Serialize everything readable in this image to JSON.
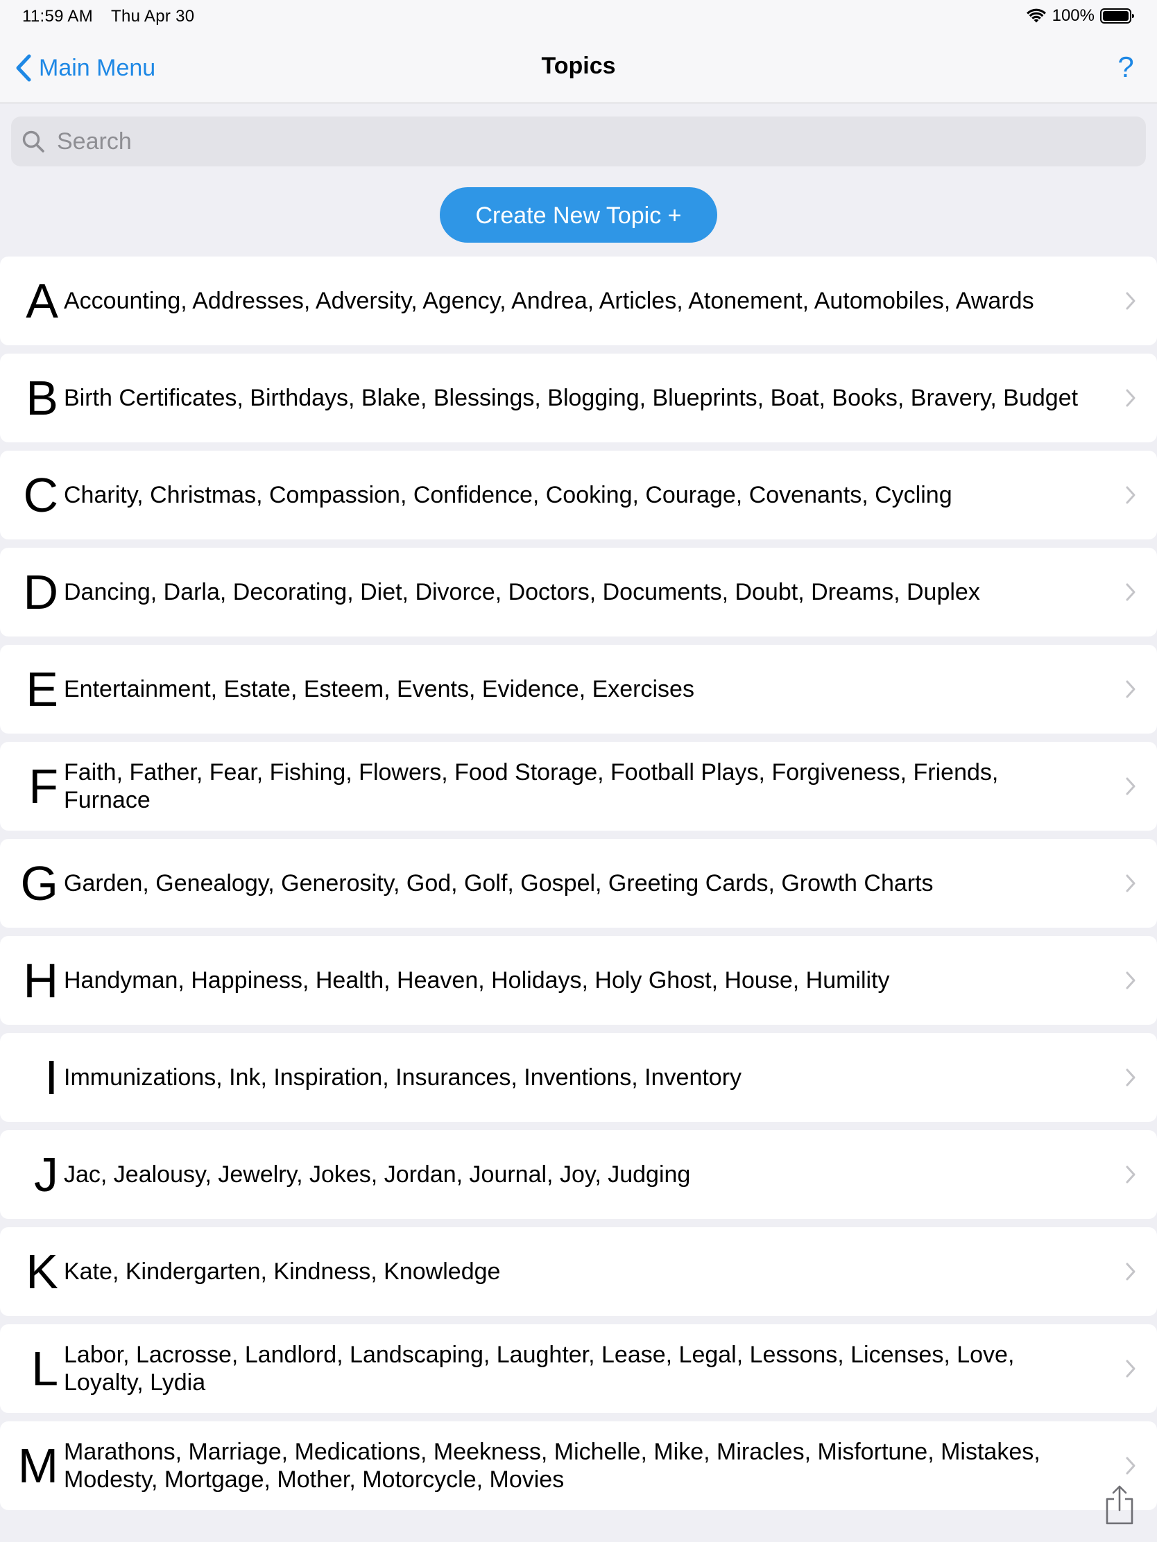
{
  "status_bar": {
    "time": "11:59 AM",
    "date": "Thu Apr 30",
    "battery": "100%"
  },
  "nav": {
    "back_label": "Main Menu",
    "title": "Topics",
    "help": "?"
  },
  "search": {
    "placeholder": "Search",
    "value": ""
  },
  "create_button": "Create New Topic +",
  "topics": [
    {
      "letter": "A",
      "items": "Accounting, Addresses, Adversity, Agency, Andrea, Articles, Atonement, Automobiles, Awards"
    },
    {
      "letter": "B",
      "items": "Birth Certificates, Birthdays, Blake, Blessings, Blogging, Blueprints, Boat, Books, Bravery, Budget"
    },
    {
      "letter": "C",
      "items": "Charity, Christmas, Compassion, Confidence, Cooking, Courage, Covenants, Cycling"
    },
    {
      "letter": "D",
      "items": "Dancing, Darla, Decorating, Diet, Divorce, Doctors, Documents, Doubt, Dreams, Duplex"
    },
    {
      "letter": "E",
      "items": "Entertainment, Estate, Esteem, Events, Evidence, Exercises"
    },
    {
      "letter": "F",
      "items": "Faith, Father, Fear, Fishing, Flowers, Food Storage, Football Plays, Forgiveness, Friends, Furnace"
    },
    {
      "letter": "G",
      "items": "Garden, Genealogy, Generosity, God, Golf, Gospel, Greeting Cards, Growth Charts"
    },
    {
      "letter": "H",
      "items": "Handyman, Happiness, Health, Heaven, Holidays, Holy Ghost, House, Humility"
    },
    {
      "letter": "I",
      "items": "Immunizations, Ink, Inspiration, Insurances, Inventions, Inventory"
    },
    {
      "letter": "J",
      "items": "Jac, Jealousy, Jewelry, Jokes, Jordan, Journal, Joy, Judging"
    },
    {
      "letter": "K",
      "items": "Kate, Kindergarten, Kindness, Knowledge"
    },
    {
      "letter": "L",
      "items": "Labor, Lacrosse, Landlord, Landscaping, Laughter, Lease, Legal, Lessons, Licenses, Love, Loyalty, Lydia"
    },
    {
      "letter": "M",
      "items": "Marathons, Marriage, Medications, Meekness, Michelle, Mike, Miracles, Misfortune, Mistakes, Modesty, Mortgage, Mother, Motorcycle, Movies"
    }
  ],
  "colors": {
    "accent": "#1e88e5",
    "button": "#2f96e6",
    "background": "#efeff4",
    "row": "#ffffff"
  },
  "icons": {
    "back": "chevron-left-icon",
    "search": "search-icon",
    "row_disclosure": "chevron-right-icon",
    "share": "share-icon",
    "wifi": "wifi-icon",
    "battery": "battery-icon"
  }
}
